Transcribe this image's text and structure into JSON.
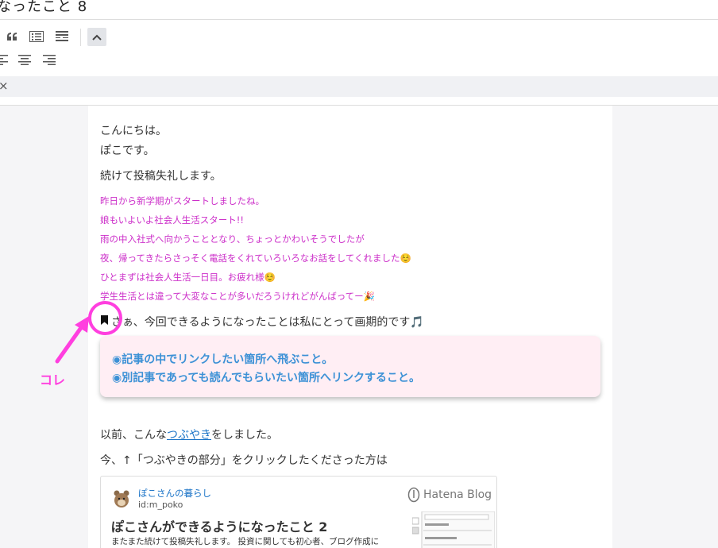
{
  "header": {
    "title": "なったこと 8"
  },
  "toolbar": {
    "row1": [
      "quote-icon",
      "list-icon",
      "more-icon",
      "collapse-icon"
    ],
    "row2": [
      "align-left-icon",
      "align-center-icon",
      "align-right-icon"
    ]
  },
  "closebar": {
    "close_label": "×"
  },
  "article": {
    "greeting1": "こんにちは。",
    "greeting2": "ぽこです。",
    "intro": "続けて投稿失礼します。",
    "pink_lines": [
      "昨日から新学期がスタートしましたね。",
      "娘もいよいよ社会人生活スタート!!",
      "雨の中入社式へ向かうこととなり、ちょっとかわいそうでしたが",
      "夜、帰ってきたらさっそく電話をくれていろいろなお話をしてくれました☺️",
      "ひとまずは社会人生活一日目。お疲れ様☺️",
      "学生生活とは違って大変なことが多いだろうけれどがんばってー🎉"
    ],
    "main_statement": "さぁ、今回できるようになったことは私にとって画期的です🎵",
    "callout": [
      "◉記事の中でリンクしたい箇所へ飛ぶこと。",
      "◉別記事であっても読んでもらいたい箇所へリンクすること。"
    ],
    "before_prefix": "以前、こんな",
    "before_link": "つぶやき",
    "before_suffix": "をしました。",
    "now_line": "今、↑「つぶやきの部分」をクリックしたくださった方は"
  },
  "annotation": {
    "label": "コレ",
    "color": "#ff3fdf"
  },
  "card": {
    "blog_name": "ぽこさんの暮らし",
    "user_id": "id:m_poko",
    "logo_text": "Hatena Blog",
    "title": "ぽこさんができるようになったこと 2",
    "excerpt": "またまた続けて投稿失礼します。 投資に関しても初心者、ブログ作成に"
  },
  "colors": {
    "pink_text": "#cc2fc9",
    "callout_bg": "#ffeef4",
    "callout_text": "#3c91d6",
    "link": "#1a73c7"
  }
}
